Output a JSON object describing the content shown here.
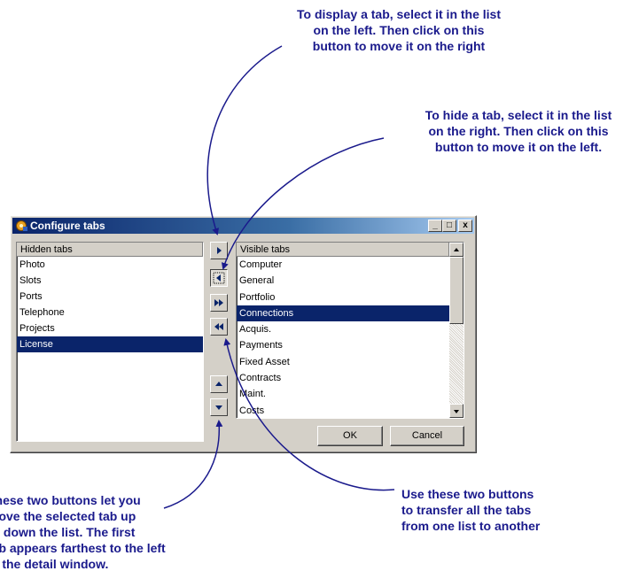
{
  "callouts": {
    "display_tab": [
      "To display a tab, select it in the list",
      "on the left. Then click on this",
      "button to move it on the right"
    ],
    "hide_tab": [
      "To hide a tab, select it in the list",
      "on the right. Then click on this",
      "button to move it on the left."
    ],
    "transfer_all": [
      "Use these two buttons",
      "to transfer all the tabs",
      "from one list to another"
    ],
    "move_up_down": [
      "These two buttons let you",
      "move the selected tab up",
      "or down the list. The first",
      "tab appears farthest to the left",
      "in the detail window."
    ],
    "color": "#1a1a8c"
  },
  "dialog": {
    "title": "Configure tabs",
    "title_icon": "app-gear-icon",
    "caption_buttons": {
      "minimize": "_",
      "maximize": "□",
      "close": "x"
    },
    "hidden_list": {
      "header": "Hidden tabs",
      "items": [
        "Photo",
        "Slots",
        "Ports",
        "Telephone",
        "Projects",
        "License"
      ],
      "selected": "License"
    },
    "visible_list": {
      "header": "Visible tabs",
      "items": [
        "Computer",
        "General",
        "Portfolio",
        "Connections",
        "Acquis.",
        "Payments",
        "Fixed Asset",
        "Contracts",
        "Maint.",
        "Costs"
      ],
      "selected": "Connections"
    },
    "tool_buttons": {
      "show": "arrow-right-icon",
      "hide": "arrow-left-icon",
      "show_all": "double-arrow-right-icon",
      "hide_all": "double-arrow-left-icon",
      "move_up": "arrow-up-icon",
      "move_down": "arrow-down-icon"
    },
    "ok_label": "OK",
    "cancel_label": "Cancel",
    "accent": "#0a246a",
    "face": "#d4d0c8"
  }
}
